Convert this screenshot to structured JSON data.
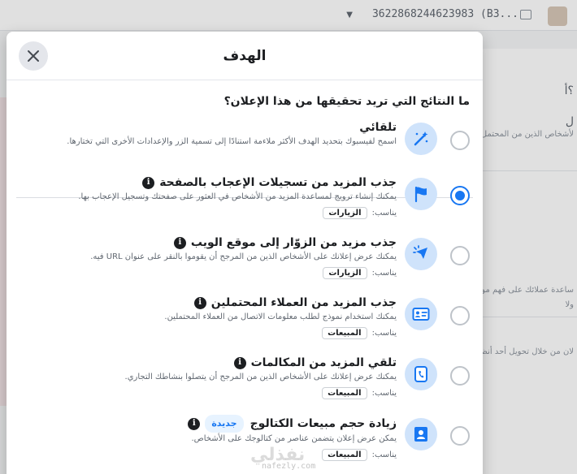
{
  "background": {
    "campaign_id": "3622868244623983 (B3...",
    "fragments": [
      "؟أ",
      "ل",
      "لأشخاص الذين من المحتمل",
      "ساعدة عملائك على فهم مو",
      "ولا",
      "لان من خلال تحويل أحد أنظ"
    ]
  },
  "modal": {
    "title": "الهدف",
    "question": "ما النتائج التي تريد تحقيقها من هذا الإعلان؟",
    "fits_label": "يناسب:",
    "options": [
      {
        "title": "تلقائي",
        "description": "اسمح لفيسبوك بتحديد الهدف الأكثر ملاءمة استنادًا إلى تسمية الزر والإعدادات الأخرى التي تختارها.",
        "icon": "magic-wand-icon",
        "selected": false
      },
      {
        "title": "جذب المزيد من تسجيلات الإعجاب بالصفحة",
        "description": "يمكنك إنشاء ترويج لمساعدة المزيد من الأشخاص في العثور على صفحتك وتسجيل الإعجاب بها.",
        "fits": "الزيارات",
        "icon": "flag-icon",
        "selected": true
      },
      {
        "title": "جذب مزيد من الزوّار إلى موقع الويب",
        "description": "يمكنك عرض إعلانك على الأشخاص الذين من المرجح أن يقوموا بالنقر على عنوان URL فيه.",
        "fits": "الزيارات",
        "icon": "cursor-click-icon",
        "selected": false
      },
      {
        "title": "جذب المزيد من العملاء المحتملين",
        "description": "يمكنك استخدام نموذج لطلب معلومات الاتصال من العملاء المحتملين.",
        "fits": "المبيعات",
        "icon": "contact-card-icon",
        "selected": false
      },
      {
        "title": "تلقي المزيد من المكالمات",
        "description": "يمكنك عرض إعلانك على الأشخاص الذين من المرجح أن يتصلوا بنشاطك التجاري.",
        "fits": "المبيعات",
        "icon": "phone-call-icon",
        "selected": false
      },
      {
        "title": "زيادة حجم مبيعات الكتالوج",
        "badge": "جديدة",
        "description": "يمكن عرض إعلان يتضمن عناصر من كتالوجك على الأشخاص.",
        "fits": "المبيعات",
        "icon": "catalog-bag-icon",
        "selected": false
      }
    ]
  },
  "watermark": {
    "text": "نفذلي",
    "sub": "nafezly.com"
  },
  "colors": {
    "accent": "#1877f2",
    "icon_bg": "#cfe3fb"
  }
}
